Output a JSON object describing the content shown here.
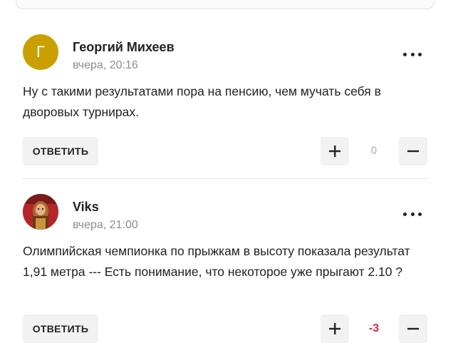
{
  "comments": [
    {
      "avatar_letter": "Г",
      "author": "Георгий Михеев",
      "time": "вчера, 20:16",
      "text": "Ну с такими результатами пора на пенсию, чем мучать себя в дворовых турнирах.",
      "reply_label": "ОТВЕТИТЬ",
      "score": "0",
      "score_color": "#c8c8c8"
    },
    {
      "avatar_letter": "",
      "author": "Viks",
      "time": "вчера, 21:00",
      "text": "Олимпийская чемпионка по прыжкам в высоту показала результат 1,91 метра --- Есть понимание, что некоторое уже прыгают 2.10 ?",
      "reply_label": "ОТВЕТИТЬ",
      "score": "-3",
      "score_color": "#e0244a"
    }
  ],
  "colors": {
    "avatar_letter_bg": "#c9a000",
    "button_bg": "#f2f2f2",
    "negative": "#e0244a",
    "muted": "#8c8c8c"
  },
  "icons": {
    "more": "more-horizontal-icon",
    "upvote": "plus-icon",
    "downvote": "minus-icon"
  }
}
